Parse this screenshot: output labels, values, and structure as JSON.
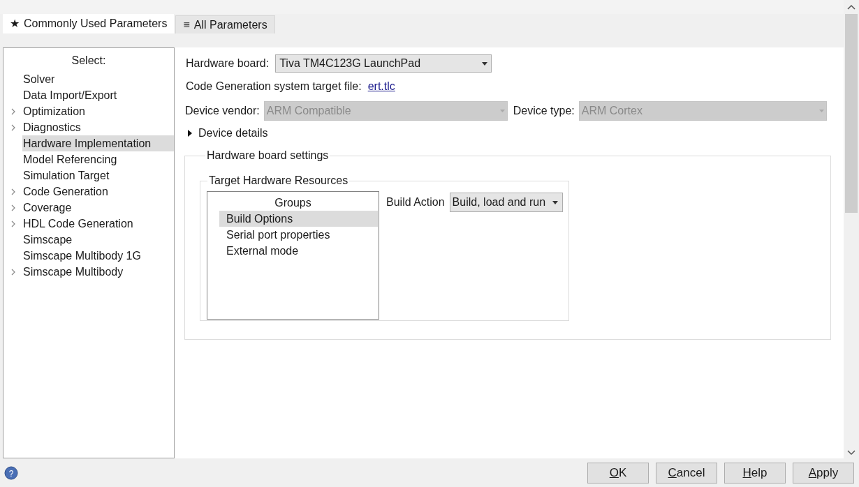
{
  "tabs": [
    {
      "icon": "★",
      "label": "Commonly Used Parameters",
      "selected": true
    },
    {
      "icon": "≡",
      "label": "All Parameters",
      "selected": false
    }
  ],
  "sidebar": {
    "title": "Select:",
    "items": [
      {
        "label": "Solver",
        "expandable": false,
        "selected": false
      },
      {
        "label": "Data Import/Export",
        "expandable": false,
        "selected": false
      },
      {
        "label": "Optimization",
        "expandable": true,
        "selected": false
      },
      {
        "label": "Diagnostics",
        "expandable": true,
        "selected": false
      },
      {
        "label": "Hardware Implementation",
        "expandable": false,
        "selected": true
      },
      {
        "label": "Model Referencing",
        "expandable": false,
        "selected": false
      },
      {
        "label": "Simulation Target",
        "expandable": false,
        "selected": false
      },
      {
        "label": "Code Generation",
        "expandable": true,
        "selected": false
      },
      {
        "label": "Coverage",
        "expandable": true,
        "selected": false
      },
      {
        "label": "HDL Code Generation",
        "expandable": true,
        "selected": false
      },
      {
        "label": "Simscape",
        "expandable": false,
        "selected": false
      },
      {
        "label": "Simscape Multibody 1G",
        "expandable": false,
        "selected": false
      },
      {
        "label": "Simscape Multibody",
        "expandable": true,
        "selected": false
      }
    ]
  },
  "hardware_board": {
    "label": "Hardware board:",
    "value": "Tiva TM4C123G LaunchPad"
  },
  "target_file": {
    "label": "Code Generation system target file:",
    "link": "ert.tlc"
  },
  "device_vendor": {
    "label": "Device vendor:",
    "value": "ARM Compatible",
    "disabled": true
  },
  "device_type": {
    "label": "Device type:",
    "value": "ARM Cortex",
    "disabled": true
  },
  "device_details": {
    "label": "Device details",
    "expanded": false
  },
  "board_settings": {
    "title": "Hardware board settings",
    "resources": {
      "title": "Target Hardware Resources",
      "groups": {
        "title": "Groups",
        "items": [
          {
            "label": "Build Options",
            "selected": true
          },
          {
            "label": "Serial port properties",
            "selected": false
          },
          {
            "label": "External mode",
            "selected": false
          }
        ]
      },
      "build_action": {
        "label": "Build Action",
        "value": "Build, load and run"
      }
    }
  },
  "help": {
    "symbol": "?"
  },
  "buttons": [
    {
      "mnemonic": "O",
      "rest": "K"
    },
    {
      "mnemonic": "C",
      "rest": "ancel"
    },
    {
      "mnemonic": "H",
      "rest": "elp"
    },
    {
      "mnemonic": "A",
      "rest": "pply"
    }
  ]
}
